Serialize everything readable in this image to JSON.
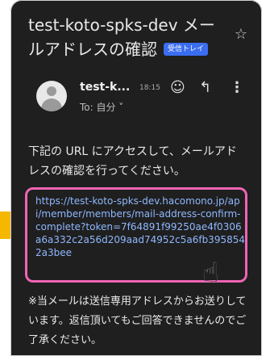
{
  "email": {
    "subject_line1": "test-koto-spks-dev メー",
    "subject_line2": "ルアドレスの確認",
    "badge": "受信トレイ",
    "star_icon": "star-icon",
    "sender": "test-k...",
    "time": "18:15",
    "to": "To: 自分 ˅",
    "body_intro": "下記の URL にアクセスして、メールアドレスの確認を行ってください。",
    "link": "https://test-koto-spks-dev.hacomono.jp/api/member/members/mail-address-confirm-complete?token=7f64891f99250ae4f0306a6a332c2a56d209aad74952c5a6fb3958542a3bee",
    "footer": "※当メールは送信専用アドレスからお送りしています。返信頂いてもご回答できませんのでご了承ください。"
  },
  "colors": {
    "background": "#1f1f1f",
    "link": "#8fb8ff",
    "highlight": "#ef64b4",
    "badge": "#3a6df0",
    "arrow": "#f5b800"
  }
}
